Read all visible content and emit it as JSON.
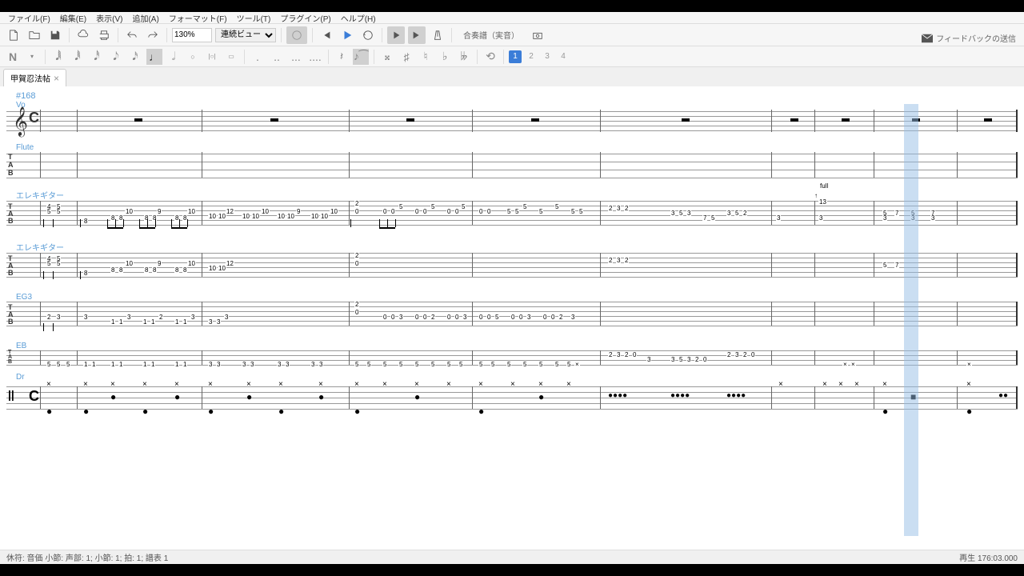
{
  "menu": {
    "file": "ファイル(F)",
    "edit": "編集(E)",
    "view": "表示(V)",
    "add": "追加(A)",
    "format": "フォーマット(F)",
    "tool": "ツール(T)",
    "plugin": "プラグイン(P)",
    "help": "ヘルプ(H)"
  },
  "toolbar": {
    "zoom": "130%",
    "view_mode": "連続ビュー",
    "score_info": "合奏譜（実音）"
  },
  "feedback": "フィードバックの送信",
  "tab": {
    "title": "甲賀忍法帖"
  },
  "voices": {
    "active": "1",
    "v2": "2",
    "v3": "3",
    "v4": "4"
  },
  "measure_num": "#168",
  "tracks": {
    "vo": "Vo",
    "flute": "Flute",
    "eg1": "エレキギター",
    "eg2": "エレキギター",
    "eg3": "EG3",
    "eb": "EB",
    "dr": "Dr"
  },
  "annotations": {
    "full": "full",
    "bend_13": "13"
  },
  "status": {
    "left": "休符: 音価  小節:  声部: 1;  小節: 1; 拍: 1; 譜表 1",
    "right": "再生  176:03.000"
  },
  "timesig": "C",
  "tab_letters": {
    "t": "T",
    "a": "A",
    "b": "B"
  },
  "drum_percussion": "||",
  "chart_data": {
    "tracks": [
      {
        "name": "Vo",
        "type": "standard",
        "measures_168_177": "rests"
      },
      {
        "name": "Flute",
        "type": "tab",
        "strings": 4,
        "measures_168_177": "empty"
      },
      {
        "name": "エレキギター1",
        "type": "tab",
        "strings": 6,
        "patterns": [
          {
            "m": 168,
            "notes": "4-5/5-5/8 ... 10-8/9-8/10-8..."
          },
          {
            "m": 169,
            "notes": "10-10/12-10/10-10.../10-10/9-10..."
          },
          {
            "m": 170,
            "notes": "2-0/5/0-0.../5/0-0/5/0-0"
          },
          {
            "m": 171,
            "notes": "0-0/5/5-5.../5/5/5-5"
          },
          {
            "m": 172,
            "notes": "2-3-2/.../3-5-3/.../3-5-2/.../7-5/3"
          },
          {
            "m": 173,
            "notes": "13 bend full"
          },
          {
            "m": 174,
            "notes": "5-7-5-7/3-3-3"
          }
        ]
      },
      {
        "name": "エレキギター2",
        "type": "tab",
        "strings": 6,
        "patterns": "same as エレキギター1"
      },
      {
        "name": "EG3",
        "type": "tab",
        "strings": 6,
        "patterns": [
          {
            "m": 168,
            "notes": "2-3/.../3/1-1/3/1-1/2/1-1/3/1-1"
          },
          {
            "m": 169,
            "notes": "3-3/3/3-3/3/.../3-3"
          },
          {
            "m": 170,
            "notes": "2-0/0-0-3/0-0-2/0-0-3"
          },
          {
            "m": 171,
            "notes": "0-0-5/0-0-3/0-0-2-3"
          }
        ]
      },
      {
        "name": "EB",
        "type": "tab",
        "strings": 4,
        "patterns": [
          {
            "m": 168,
            "notes": "5-5-5/1-1/1-1/1-1/1-1"
          },
          {
            "m": 169,
            "notes": "3-3/3-3/3-3/3-3"
          },
          {
            "m": 170,
            "notes": "5-5-5-5-5-5-5-5"
          },
          {
            "m": 171,
            "notes": "5-5-5-5-5-5-5-5"
          },
          {
            "m": 172,
            "notes": "2-3-2-0/3/3-5-3-2-0/2-3-2-0"
          }
        ]
      },
      {
        "name": "Dr",
        "type": "percussion",
        "measures": "drum patterns with hihat, kick, snare"
      }
    ]
  }
}
